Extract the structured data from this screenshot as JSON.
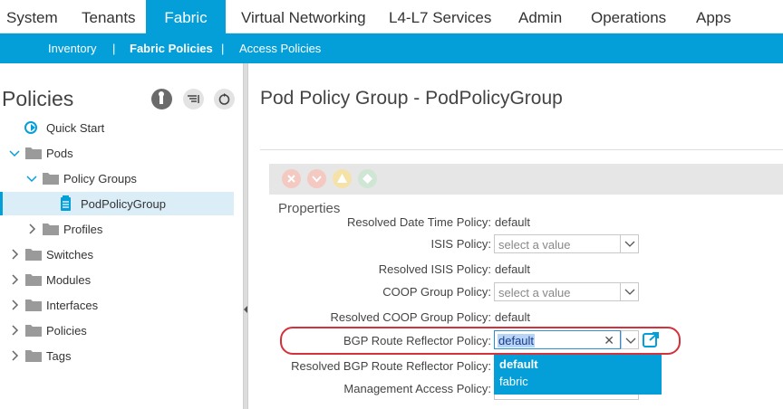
{
  "topnav": {
    "tabs": [
      "System",
      "Tenants",
      "Fabric",
      "Virtual Networking",
      "L4-L7 Services",
      "Admin",
      "Operations",
      "Apps"
    ],
    "active": "Fabric"
  },
  "subnav": {
    "items": [
      "Inventory",
      "Fabric Policies",
      "Access Policies"
    ],
    "separator": "|",
    "active": "Fabric Policies"
  },
  "left": {
    "title": "Policies",
    "tree": [
      {
        "label": "Quick Start"
      },
      {
        "label": "Pods"
      },
      {
        "label": "Policy Groups"
      },
      {
        "label": "PodPolicyGroup"
      },
      {
        "label": "Profiles"
      },
      {
        "label": "Switches"
      },
      {
        "label": "Modules"
      },
      {
        "label": "Interfaces"
      },
      {
        "label": "Policies"
      },
      {
        "label": "Tags"
      }
    ]
  },
  "main": {
    "title": "Pod Policy Group - PodPolicyGroup",
    "section": "Properties",
    "fields": {
      "resolved_datetime": {
        "label": "Resolved Date Time Policy:",
        "value": "default"
      },
      "isis": {
        "label": "ISIS Policy:",
        "placeholder": "select a value"
      },
      "resolved_isis": {
        "label": "Resolved ISIS Policy:",
        "value": "default"
      },
      "coop": {
        "label": "COOP Group Policy:",
        "placeholder": "select a value"
      },
      "resolved_coop": {
        "label": "Resolved COOP Group Policy:",
        "value": "default"
      },
      "bgp": {
        "label": "BGP Route Reflector Policy:",
        "value": "default",
        "clear": "✕"
      },
      "resolved_bgp": {
        "label": "Resolved BGP Route Reflector Policy:"
      },
      "mgmt": {
        "label": "Management Access Policy:"
      }
    },
    "dropdown_options": [
      "default",
      "fabric"
    ]
  },
  "colors": {
    "accent": "#049fd9",
    "highlight": "#d4313a"
  }
}
